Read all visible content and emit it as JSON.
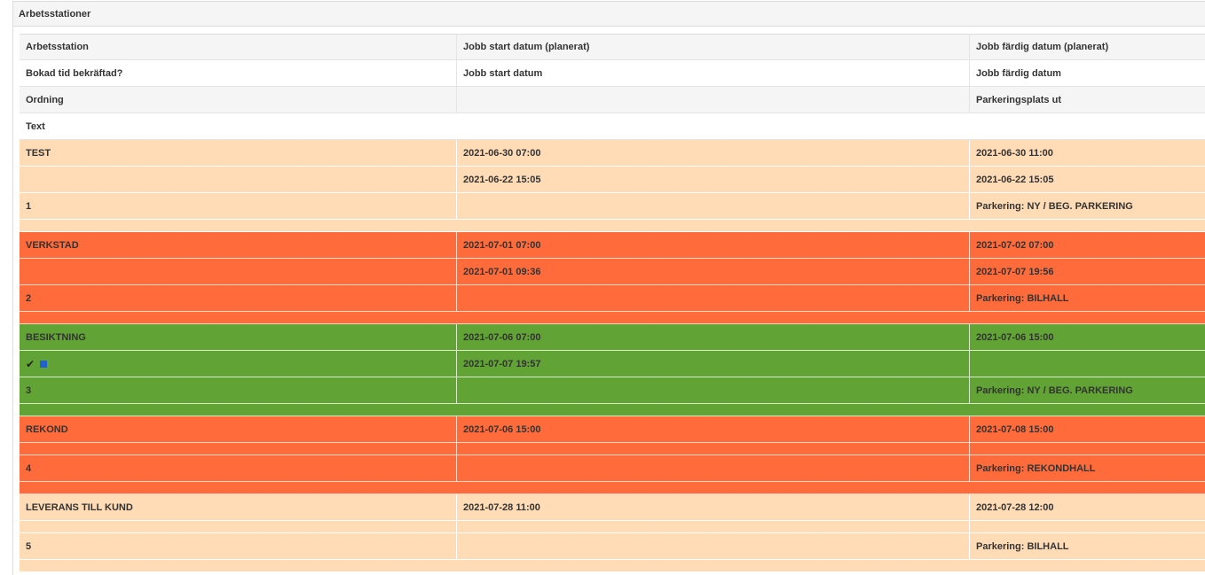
{
  "panel": {
    "title": "Arbetsstationer"
  },
  "headers": {
    "row1": [
      "Arbetsstation",
      "Jobb start datum (planerat)",
      "Jobb färdig datum (planerat)"
    ],
    "row2": [
      "Bokad tid bekräftad?",
      "Jobb start datum",
      "Jobb färdig datum"
    ],
    "row3": [
      "Ordning",
      "",
      "Parkeringsplats ut"
    ],
    "row4": "Text"
  },
  "stations": [
    {
      "name": "TEST",
      "color": "#ffdcb6",
      "planned_start": "2021-06-30 07:00",
      "planned_end": "2021-06-30 11:00",
      "confirmed": "",
      "start": "2021-06-22 15:05",
      "end": "2021-06-22 15:05",
      "order": "1",
      "parking": "Parkering: NY / BEG. PARKERING"
    },
    {
      "name": "VERKSTAD",
      "color": "#ff6b3b",
      "planned_start": "2021-07-01 07:00",
      "planned_end": "2021-07-02 07:00",
      "confirmed": "",
      "start": "2021-07-01 09:36",
      "end": "2021-07-07 19:56",
      "order": "2",
      "parking": "Parkering: BILHALL"
    },
    {
      "name": "BESIKTNING",
      "color": "#61a334",
      "planned_start": "2021-07-06 07:00",
      "planned_end": "2021-07-06 15:00",
      "confirmed_icons": [
        "check-icon",
        "square-icon"
      ],
      "start": "2021-07-07 19:57",
      "end": "",
      "order": "3",
      "parking": "Parkering: NY / BEG. PARKERING"
    },
    {
      "name": "REKOND",
      "color": "#ff6b3b",
      "planned_start": "2021-07-06 15:00",
      "planned_end": "2021-07-08 15:00",
      "confirmed": "",
      "start": "",
      "end": "",
      "order": "4",
      "parking": "Parkering: REKONDHALL"
    },
    {
      "name": "LEVERANS TILL KUND",
      "color": "#ffdcb6",
      "planned_start": "2021-07-28 11:00",
      "planned_end": "2021-07-28 12:00",
      "confirmed": "",
      "start": "",
      "end": "",
      "order": "5",
      "parking": "Parkering: BILHALL"
    }
  ]
}
